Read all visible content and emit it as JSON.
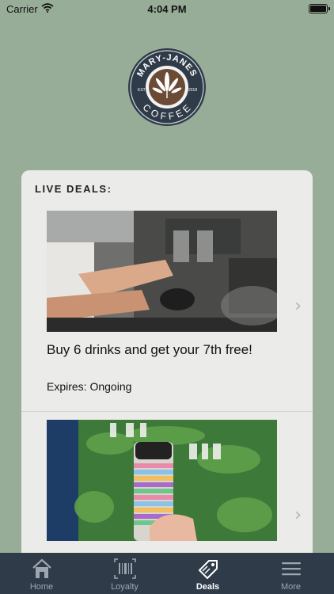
{
  "status_bar": {
    "carrier": "Carrier",
    "time": "4:04 PM"
  },
  "logo": {
    "top_text": "MARY-JANES",
    "bottom_text": "COFFEE",
    "est_label": "EST",
    "year": "2018"
  },
  "deals": {
    "section_title": "LIVE DEALS:",
    "items": [
      {
        "title": "Buy 6 drinks and get your 7th free!",
        "expires": "Expires: Ongoing"
      },
      {
        "title": "",
        "expires": ""
      }
    ]
  },
  "tab_bar": {
    "tabs": [
      {
        "label": "Home",
        "icon": "home-icon"
      },
      {
        "label": "Loyalty",
        "icon": "barcode-icon"
      },
      {
        "label": "Deals",
        "icon": "tag-icon",
        "active": true
      },
      {
        "label": "More",
        "icon": "menu-icon"
      }
    ]
  },
  "colors": {
    "background": "#98ad98",
    "card": "#ebebe9",
    "tab_bar": "#2f3b48",
    "logo_ring": "#2f3b48",
    "logo_center": "#6b4a36"
  }
}
